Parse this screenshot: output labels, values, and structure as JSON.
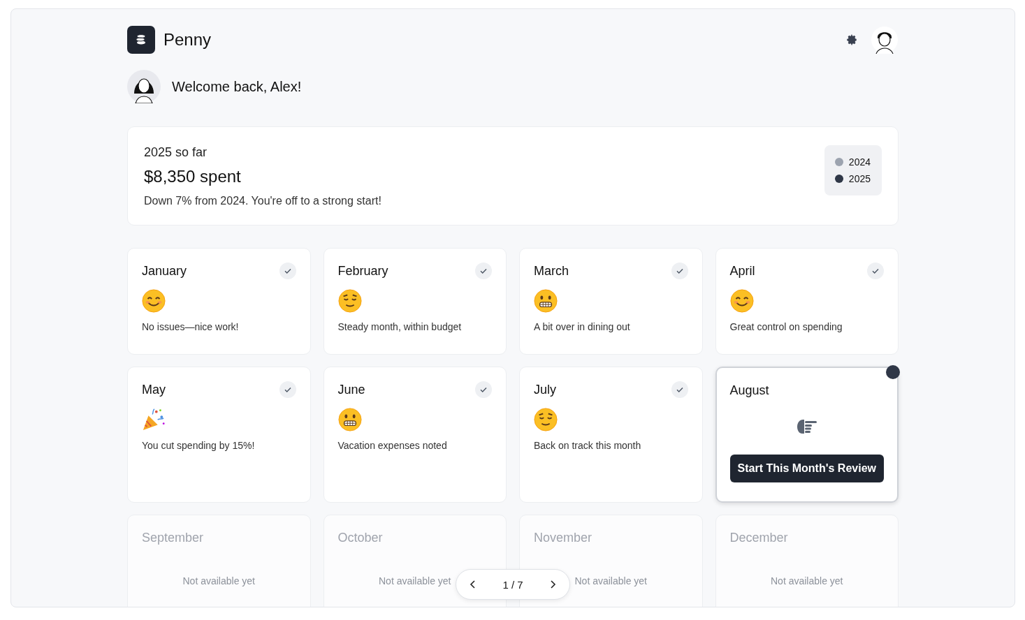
{
  "app": {
    "name": "Penny"
  },
  "greeting": "Welcome back, Alex!",
  "summary": {
    "title": "2025 so far",
    "amount": "$8,350 spent",
    "note": "Down 7% from 2024. You're off to a strong start!",
    "legend": [
      {
        "label": "2024",
        "color": "#9ca3af"
      },
      {
        "label": "2025",
        "color": "#2f3747"
      }
    ]
  },
  "months": [
    {
      "name": "January",
      "kind": "done",
      "face": {
        "kind": "smile"
      },
      "note": "No issues—nice work!"
    },
    {
      "name": "February",
      "kind": "done",
      "face": {
        "kind": "relieved"
      },
      "note": "Steady month, within budget"
    },
    {
      "name": "March",
      "kind": "done",
      "face": {
        "kind": "grimace"
      },
      "note": "A bit over in dining out"
    },
    {
      "name": "April",
      "kind": "done",
      "face": {
        "kind": "smile"
      },
      "note": "Great control on spending"
    },
    {
      "name": "May",
      "kind": "done",
      "face": {
        "kind": "party"
      },
      "note": "You cut spending by 15%!"
    },
    {
      "name": "June",
      "kind": "done",
      "face": {
        "kind": "grimace"
      },
      "note": "Vacation expenses noted"
    },
    {
      "name": "July",
      "kind": "done",
      "face": {
        "kind": "relieved"
      },
      "note": "Back on track this month"
    },
    {
      "name": "August",
      "kind": "current",
      "action": "Start This Month's Review"
    },
    {
      "name": "September",
      "kind": "locked",
      "note": "Not available yet"
    },
    {
      "name": "October",
      "kind": "locked",
      "note": "Not available yet"
    },
    {
      "name": "November",
      "kind": "locked",
      "note": "Not available yet"
    },
    {
      "name": "December",
      "kind": "locked",
      "note": "Not available yet"
    }
  ],
  "pager": {
    "label": "1 / 7"
  }
}
